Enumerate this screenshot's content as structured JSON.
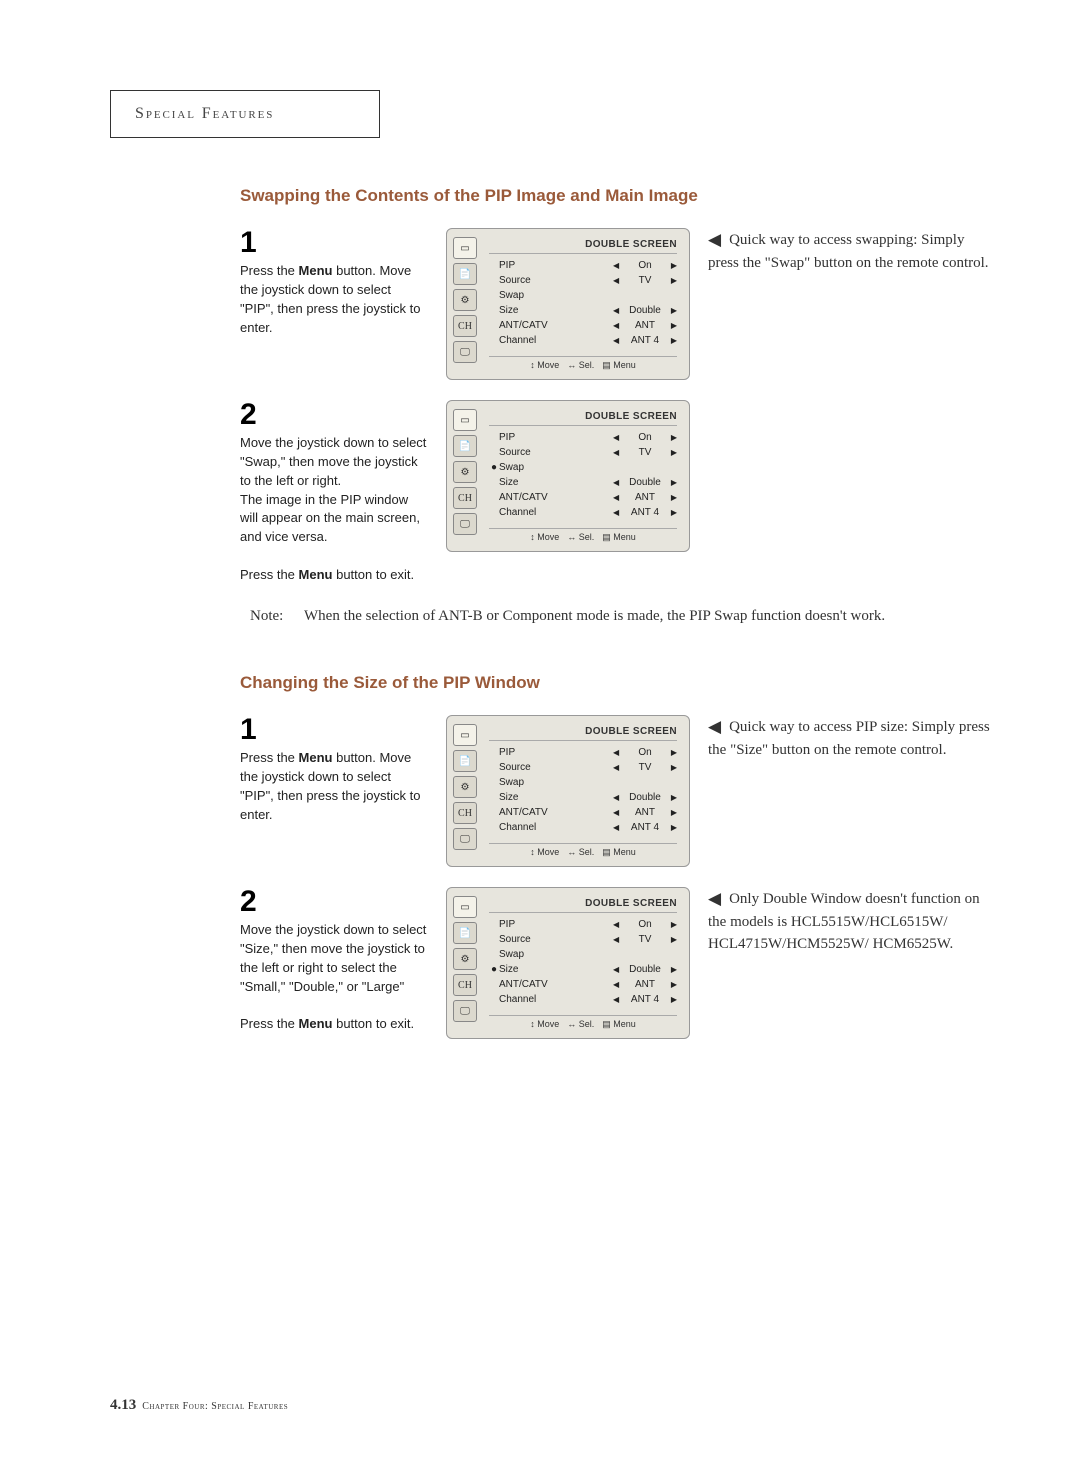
{
  "section_header": "Special Features",
  "headings": {
    "swap": "Swapping the Contents of the PIP Image and Main Image",
    "size": "Changing the Size of the PIP Window"
  },
  "swap": {
    "step1": {
      "num": "1",
      "p1a": "Press the ",
      "p1b": "Menu",
      "p1c": " button. Move the joystick down to select \"PIP\", then press the joystick to enter."
    },
    "step2": {
      "num": "2",
      "p1": "Move the joystick down to select \"Swap,\" then move the joystick to the left or right.",
      "p2": "The image in the PIP window will appear on the main screen, and vice versa.",
      "p3a": "Press the ",
      "p3b": "Menu",
      "p3c": " button to exit."
    },
    "tip": "Quick way to access swapping: Simply press the \"Swap\" button on the remote control."
  },
  "note": {
    "label": "Note:",
    "body": "When the selection of ANT-B or Component mode is made, the PIP Swap function doesn't work."
  },
  "size": {
    "step1": {
      "num": "1",
      "p1a": "Press the ",
      "p1b": "Menu",
      "p1c": " button. Move the joystick down to select \"PIP\", then press the joystick to enter."
    },
    "step2": {
      "num": "2",
      "p1": "Move the joystick down to select \"Size,\" then move the joystick to the left or right to select the \"Small,\" \"Double,\" or \"Large\"",
      "p2a": "Press the ",
      "p2b": "Menu",
      "p2c": " button to exit."
    },
    "tip1": "Quick way to access PIP size: Simply press the \"Size\" button on the remote control.",
    "tip2": "Only Double Window doesn't function on the models is HCL5515W/HCL6515W/ HCL4715W/HCM5525W/ HCM6525W."
  },
  "osd": {
    "title": "DOUBLE SCREEN",
    "tabs": [
      "▭",
      "📄",
      "⚙",
      "CH",
      "🖵"
    ],
    "rows": {
      "pip": {
        "label": "PIP",
        "value": "On"
      },
      "source": {
        "label": "Source",
        "value": "TV"
      },
      "swap": {
        "label": "Swap",
        "value": ""
      },
      "size": {
        "label": "Size",
        "value": "Double"
      },
      "antcatv": {
        "label": "ANT/CATV",
        "value": "ANT"
      },
      "channel": {
        "label": "Channel",
        "value": "ANT 4"
      }
    },
    "footer": {
      "move": "Move",
      "sel": "Sel.",
      "menu": "Menu"
    }
  },
  "footer": {
    "page": "4.13",
    "chapter": "Chapter Four: Special Features"
  }
}
